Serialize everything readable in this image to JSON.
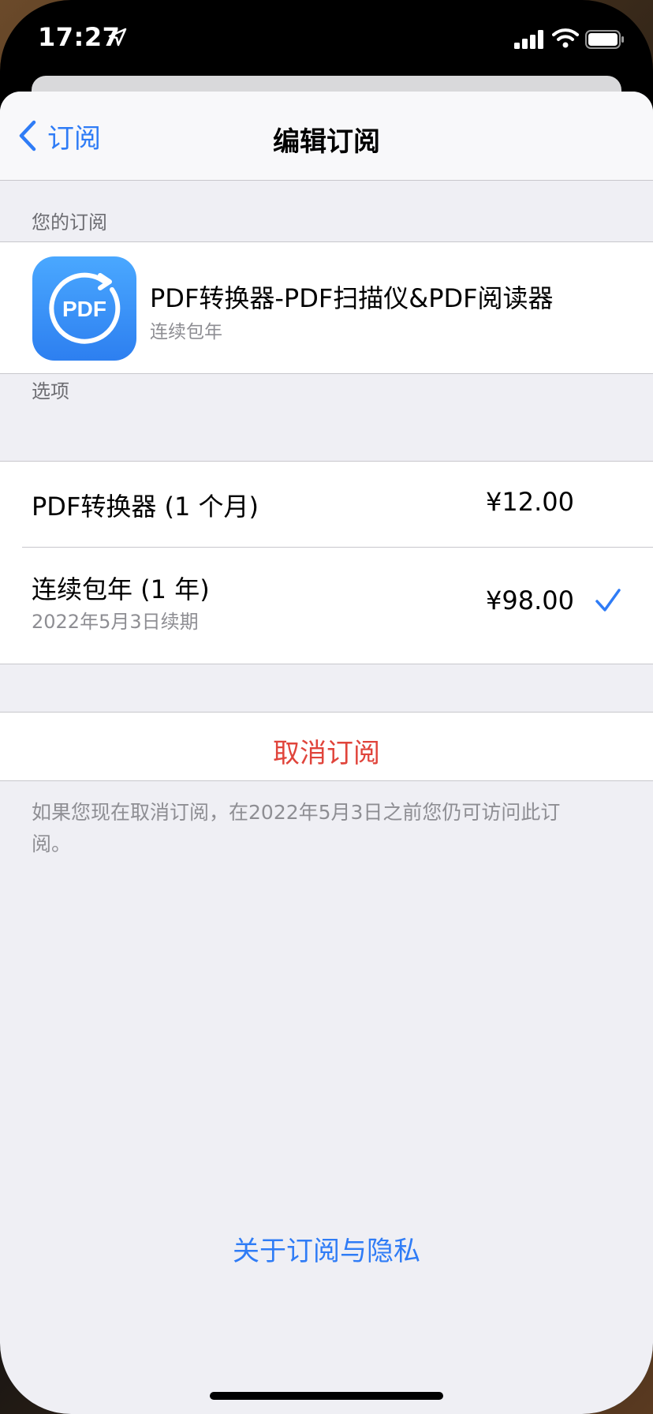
{
  "status_bar": {
    "time": "17:27",
    "icons": [
      "location-arrow-icon",
      "cellular-signal-icon",
      "wifi-icon",
      "battery-icon"
    ]
  },
  "nav": {
    "back_label": "订阅",
    "title": "编辑订阅"
  },
  "your_subscriptions": {
    "header": "您的订阅",
    "app": {
      "icon_text": "PDF",
      "name": "PDF转换器-PDF扫描仪&PDF阅读器",
      "plan": "连续包年"
    }
  },
  "options": {
    "header": "选项",
    "items": [
      {
        "title": "PDF转换器 (1 个月)",
        "price": "¥12.00",
        "selected": false
      },
      {
        "title": "连续包年 (1 年)",
        "subtitle": "2022年5月3日续期",
        "price": "¥98.00",
        "selected": true
      }
    ]
  },
  "cancel": {
    "label": "取消订阅",
    "footnote": "如果您现在取消订阅，在2022年5月3日之前您仍可访问此订阅。"
  },
  "privacy_link": "关于订阅与隐私",
  "colors": {
    "accent_blue": "#2f7cf6",
    "destructive_red": "#e0443b",
    "grouped_background": "#efeff4",
    "secondary_text": "#8e8e93"
  }
}
